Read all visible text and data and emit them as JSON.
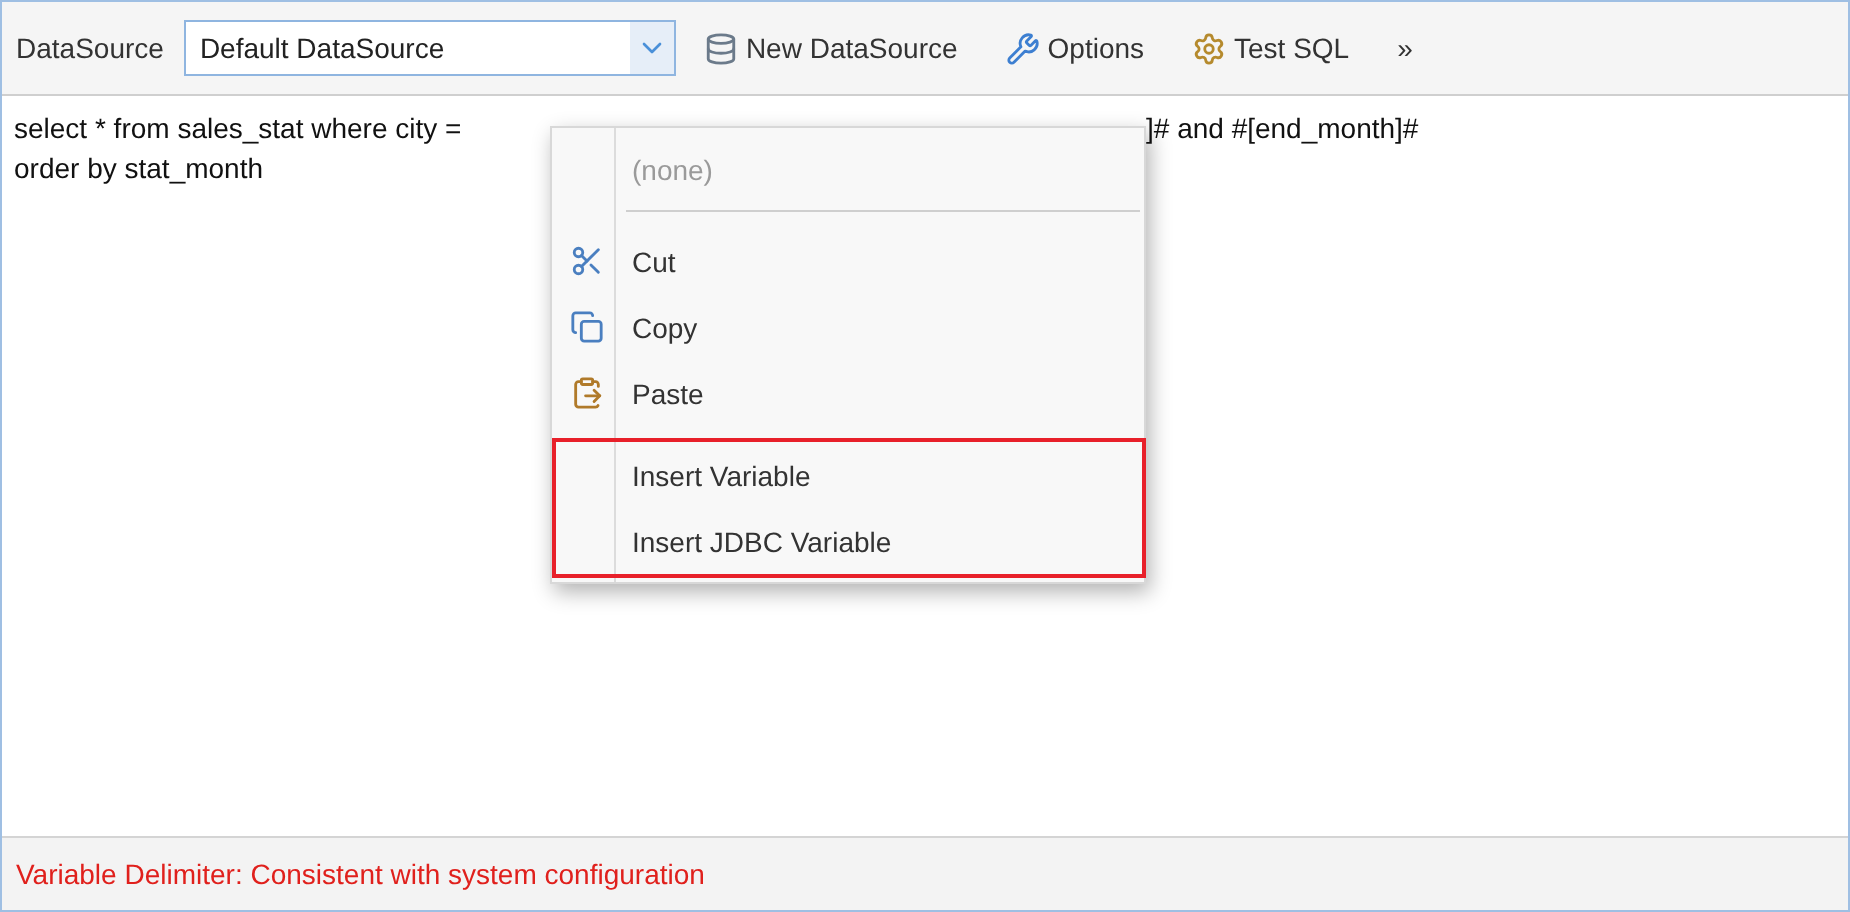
{
  "toolbar": {
    "datasource_label": "DataSource",
    "datasource_value": "Default DataSource",
    "buttons": [
      {
        "label": "New DataSource"
      },
      {
        "label": "Options"
      },
      {
        "label": "Test SQL"
      }
    ],
    "more": "»"
  },
  "editor": {
    "line_1_left": "select * from sales_stat where city =",
    "line_1_right": "]# and #[end_month]#",
    "line_2": "order by stat_month"
  },
  "context_menu": {
    "groups": [
      {
        "highlighted": false,
        "separator_after": true,
        "items": [
          {
            "label": "(none)",
            "disabled": true
          }
        ]
      },
      {
        "highlighted": false,
        "separator_after": false,
        "items": [
          {
            "label": "Cut",
            "disabled": false
          },
          {
            "label": "Copy",
            "disabled": false
          },
          {
            "label": "Paste",
            "disabled": false
          }
        ]
      },
      {
        "highlighted": true,
        "separator_after": false,
        "items": [
          {
            "label": "Insert Variable",
            "disabled": false
          },
          {
            "label": "Insert JDBC Variable",
            "disabled": false
          }
        ]
      }
    ]
  },
  "status_bar": {
    "text": "Variable Delimiter: Consistent with system configuration"
  }
}
